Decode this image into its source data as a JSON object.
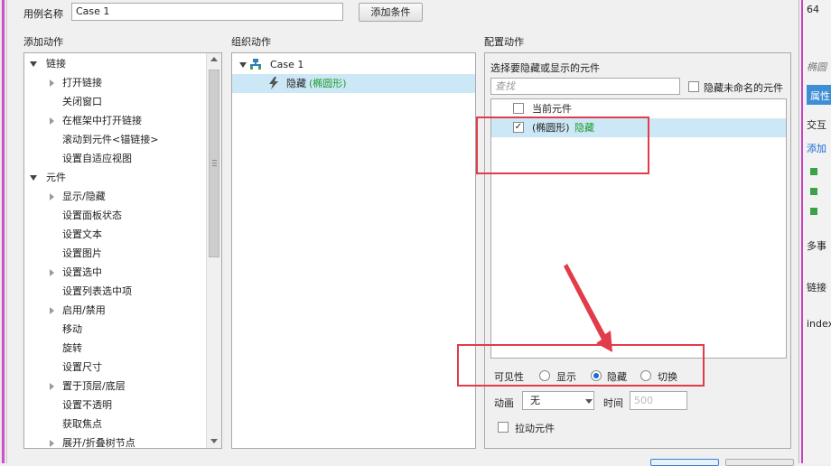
{
  "case_name": {
    "label": "用例名称",
    "value": "Case 1"
  },
  "add_condition_button": "添加条件",
  "columns": {
    "add_action": "添加动作",
    "organize_action": "组织动作",
    "configure_action": "配置动作"
  },
  "add_action_tree": [
    {
      "label": "链接",
      "level": 0,
      "expander": "open"
    },
    {
      "label": "打开链接",
      "level": 1,
      "expander": "closed"
    },
    {
      "label": "关闭窗口",
      "level": 1,
      "expander": "none"
    },
    {
      "label": "在框架中打开链接",
      "level": 1,
      "expander": "closed"
    },
    {
      "label": "滚动到元件<锚链接>",
      "level": 1,
      "expander": "none"
    },
    {
      "label": "设置自适应视图",
      "level": 1,
      "expander": "none"
    },
    {
      "label": "元件",
      "level": 0,
      "expander": "open"
    },
    {
      "label": "显示/隐藏",
      "level": 1,
      "expander": "closed"
    },
    {
      "label": "设置面板状态",
      "level": 1,
      "expander": "none"
    },
    {
      "label": "设置文本",
      "level": 1,
      "expander": "none"
    },
    {
      "label": "设置图片",
      "level": 1,
      "expander": "none"
    },
    {
      "label": "设置选中",
      "level": 1,
      "expander": "closed"
    },
    {
      "label": "设置列表选中项",
      "level": 1,
      "expander": "none"
    },
    {
      "label": "启用/禁用",
      "level": 1,
      "expander": "closed"
    },
    {
      "label": "移动",
      "level": 1,
      "expander": "none"
    },
    {
      "label": "旋转",
      "level": 1,
      "expander": "none"
    },
    {
      "label": "设置尺寸",
      "level": 1,
      "expander": "none"
    },
    {
      "label": "置于顶层/底层",
      "level": 1,
      "expander": "closed"
    },
    {
      "label": "设置不透明",
      "level": 1,
      "expander": "none"
    },
    {
      "label": "获取焦点",
      "level": 1,
      "expander": "none"
    },
    {
      "label": "展开/折叠树节点",
      "level": 1,
      "expander": "closed"
    }
  ],
  "organize_tree": {
    "case_label": "Case 1",
    "action_label": "隐藏",
    "action_target": "(椭圆形)"
  },
  "configure": {
    "heading": "选择要隐藏或显示的元件",
    "search_placeholder": "查找",
    "hide_unnamed_label": "隐藏未命名的元件",
    "widgets": [
      {
        "label": "当前元件",
        "checked": false,
        "suffix": ""
      },
      {
        "label": "(椭圆形)",
        "checked": true,
        "suffix": "隐藏"
      }
    ],
    "visibility_label": "可见性",
    "visibility_options": [
      "显示",
      "隐藏",
      "切换"
    ],
    "visibility_selected": "隐藏",
    "animation_label": "动画",
    "animation_value": "无",
    "time_label": "时间",
    "time_value": "500",
    "drag_widget_label": "拉动元件",
    "checkmark": "✓"
  },
  "background_app": {
    "texts": [
      "64",
      "椭圆",
      "属性",
      "交互",
      "添加",
      "多事",
      "链接",
      "index"
    ]
  },
  "colors": {
    "highlight_row": "#cce8f6",
    "annotation_red": "#e23b4a",
    "action_green": "#1e9a2e"
  }
}
